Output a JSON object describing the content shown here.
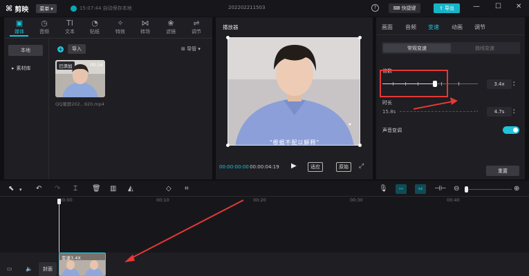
{
  "app": {
    "title": "剪映",
    "menu_label": "菜单",
    "status": "15:07:44 自动保存本地",
    "doc_title": "202202211503",
    "shortcut_label": "快捷键",
    "export_label": "导出"
  },
  "toolbar": {
    "tools": [
      {
        "label": "媒体",
        "icon": "media-icon",
        "active": true
      },
      {
        "label": "音频",
        "icon": "audio-icon"
      },
      {
        "label": "文本",
        "icon": "text-icon"
      },
      {
        "label": "贴纸",
        "icon": "sticker-icon"
      },
      {
        "label": "特效",
        "icon": "effects-icon"
      },
      {
        "label": "转场",
        "icon": "transition-icon"
      },
      {
        "label": "滤镜",
        "icon": "filter-icon"
      },
      {
        "label": "调节",
        "icon": "adjust-icon"
      }
    ]
  },
  "media": {
    "sidebar": [
      {
        "label": "本地",
        "active": true
      },
      {
        "label": "素材库",
        "active": false
      }
    ],
    "import_label": "导入",
    "sort_label": "导管",
    "item": {
      "badge": "已添加",
      "duration": "00:16",
      "name": "QQ录屏202...920.mp4"
    }
  },
  "player": {
    "title": "播放器",
    "subtitle": "\"根据不配以解释\"",
    "current_time": "00:00:00:00",
    "total_time": "00:00:04:19",
    "ratio_label": "适应",
    "original_label": "原始"
  },
  "inspector": {
    "tabs": [
      {
        "label": "画面",
        "active": false
      },
      {
        "label": "音频",
        "active": false
      },
      {
        "label": "变速",
        "active": true
      },
      {
        "label": "动画",
        "active": false
      },
      {
        "label": "调节",
        "active": false
      }
    ],
    "segments": {
      "normal": "常规变速",
      "curve": "曲线变速"
    },
    "speed": {
      "label": "倍数",
      "value": "3.4x",
      "slider_fraction": 0.55
    },
    "duration": {
      "label": "时长",
      "start": "15.8s",
      "value": "4.7s"
    },
    "pitch": {
      "label": "声音变调",
      "enabled": true
    },
    "reset_label": "重置"
  },
  "timeline": {
    "ruler": [
      "00:00",
      "00:10",
      "00:20",
      "00:30",
      "00:40"
    ],
    "cover_label": "封面",
    "clip_label": "变速3.4X"
  },
  "colors": {
    "accent": "#1ec4d8",
    "annotation": "#e53935"
  }
}
